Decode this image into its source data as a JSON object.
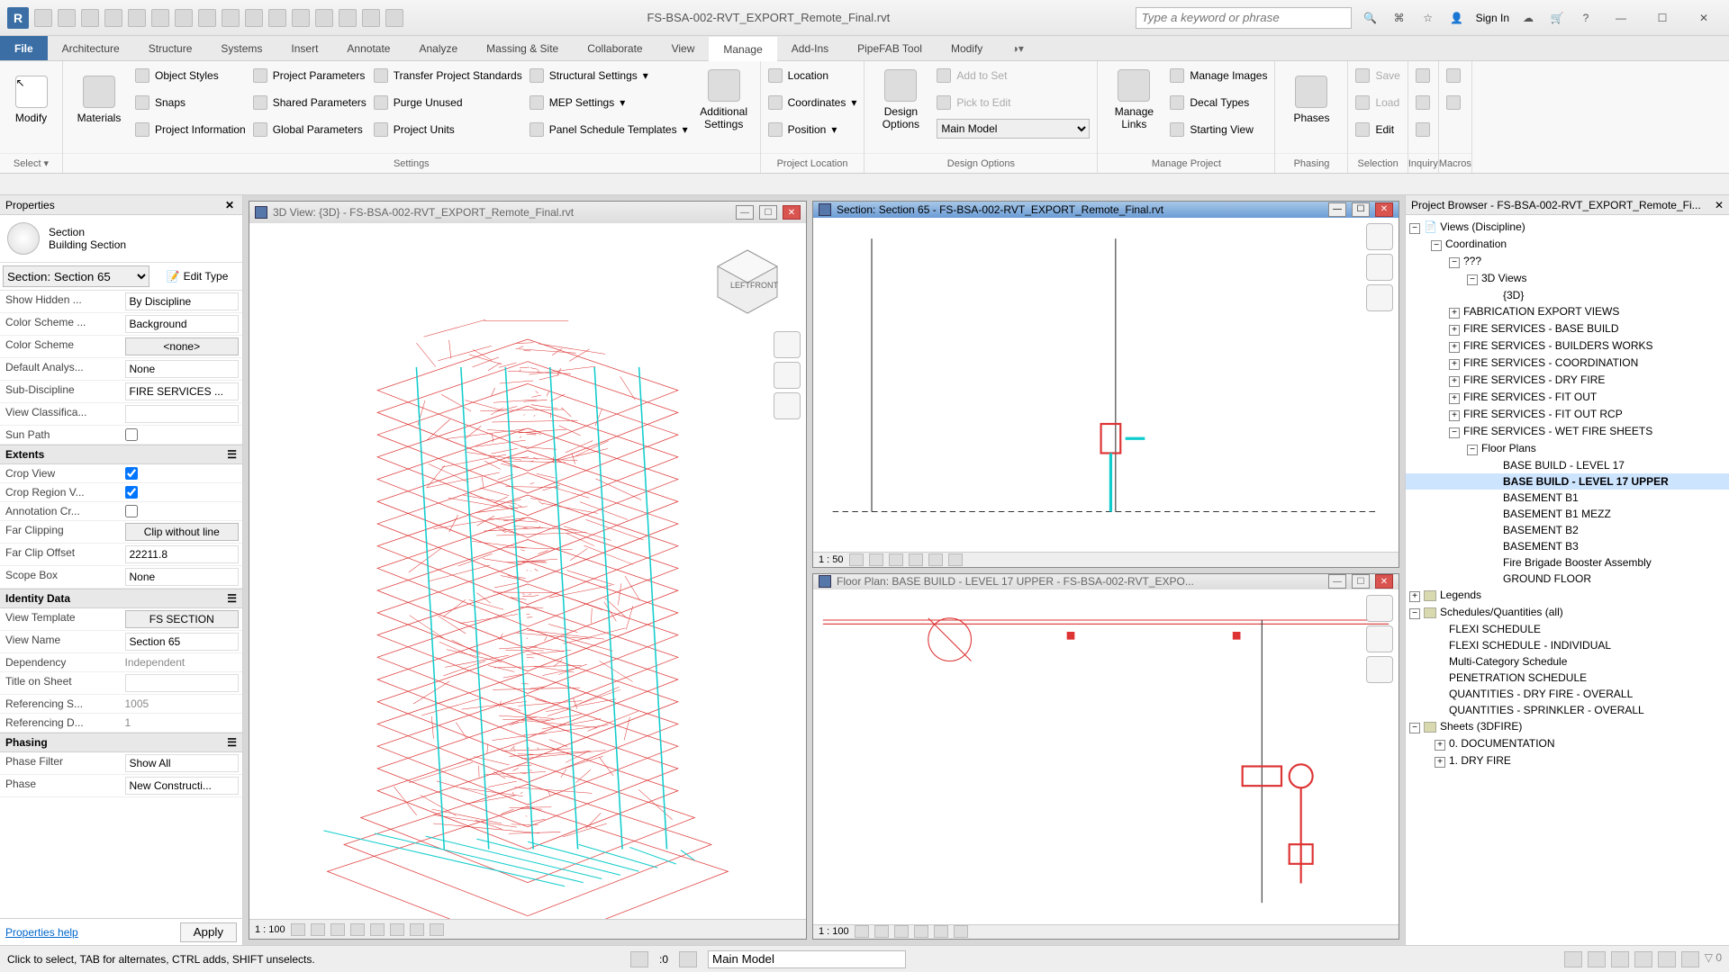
{
  "title": "FS-BSA-002-RVT_EXPORT_Remote_Final.rvt",
  "search_placeholder": "Type a keyword or phrase",
  "sign_in": "Sign In",
  "ribbon_tabs": [
    "File",
    "Architecture",
    "Structure",
    "Systems",
    "Insert",
    "Annotate",
    "Analyze",
    "Massing & Site",
    "Collaborate",
    "View",
    "Manage",
    "Add-Ins",
    "PipeFAB Tool",
    "Modify"
  ],
  "active_tab": "Manage",
  "options": {
    "select_label": "Select"
  },
  "ribbon": {
    "modify": "Modify",
    "materials": "Materials",
    "styles": {
      "object_styles": "Object  Styles",
      "snaps": "Snaps",
      "project_info": "Project  Information"
    },
    "params": {
      "project": "Project  Parameters",
      "shared": "Shared  Parameters",
      "global": "Global  Parameters"
    },
    "transfer": {
      "transfer": "Transfer  Project Standards",
      "purge": "Purge  Unused",
      "units": "Project  Units"
    },
    "settings_footer": "Settings",
    "mep": {
      "structural": "Structural  Settings",
      "mep": "MEP  Settings",
      "panel": "Panel Schedule  Templates"
    },
    "additional": "Additional\nSettings",
    "loc": {
      "location": "Location",
      "coordinates": "Coordinates",
      "position": "Position"
    },
    "project_location_footer": "Project Location",
    "design_options": "Design\nOptions",
    "do": {
      "add": "Add to Set",
      "pick": "Pick to Edit",
      "main_model": "Main Model"
    },
    "design_options_footer": "Design Options",
    "manage_links": "Manage\nLinks",
    "mp": {
      "images": "Manage  Images",
      "decal": "Decal  Types",
      "starting": "Starting  View"
    },
    "manage_project_footer": "Manage Project",
    "phases": "Phases",
    "phasing_footer": "Phasing",
    "sel": {
      "save": "Save",
      "load": "Load",
      "edit": "Edit"
    },
    "selection_footer": "Selection",
    "inquiry_footer": "Inquiry",
    "macros_footer": "Macros"
  },
  "properties": {
    "title": "Properties",
    "type_name": "Section",
    "type_family": "Building Section",
    "instance": "Section: Section 65",
    "edit_type": "Edit Type",
    "groups": [
      {
        "name": "",
        "rows": [
          {
            "k": "Show Hidden ...",
            "v": "By Discipline",
            "t": "text"
          },
          {
            "k": "Color Scheme ...",
            "v": "Background",
            "t": "text"
          },
          {
            "k": "Color Scheme",
            "v": "<none>",
            "t": "btn"
          },
          {
            "k": "Default Analys...",
            "v": "None",
            "t": "text"
          },
          {
            "k": "Sub-Discipline",
            "v": "FIRE SERVICES ...",
            "t": "text"
          },
          {
            "k": "View Classifica...",
            "v": "",
            "t": "text"
          },
          {
            "k": "Sun Path",
            "v": "",
            "t": "check",
            "checked": false
          }
        ]
      },
      {
        "name": "Extents",
        "rows": [
          {
            "k": "Crop View",
            "v": "",
            "t": "check",
            "checked": true
          },
          {
            "k": "Crop Region V...",
            "v": "",
            "t": "check",
            "checked": true
          },
          {
            "k": "Annotation Cr...",
            "v": "",
            "t": "check",
            "checked": false
          },
          {
            "k": "Far Clipping",
            "v": "Clip without line",
            "t": "btn"
          },
          {
            "k": "Far Clip Offset",
            "v": "22211.8",
            "t": "text"
          },
          {
            "k": "Scope Box",
            "v": "None",
            "t": "text"
          }
        ]
      },
      {
        "name": "Identity Data",
        "rows": [
          {
            "k": "View Template",
            "v": "FS SECTION",
            "t": "btn"
          },
          {
            "k": "View Name",
            "v": "Section 65",
            "t": "text"
          },
          {
            "k": "Dependency",
            "v": "Independent",
            "t": "ro"
          },
          {
            "k": "Title on Sheet",
            "v": "",
            "t": "text"
          },
          {
            "k": "Referencing S...",
            "v": "1005",
            "t": "ro"
          },
          {
            "k": "Referencing D...",
            "v": "1",
            "t": "ro"
          }
        ]
      },
      {
        "name": "Phasing",
        "rows": [
          {
            "k": "Phase Filter",
            "v": "Show All",
            "t": "text"
          },
          {
            "k": "Phase",
            "v": "New Constructi...",
            "t": "text"
          }
        ]
      }
    ],
    "help": "Properties help",
    "apply": "Apply"
  },
  "viewports": {
    "section": {
      "title": "Section: Section 65 - FS-BSA-002-RVT_EXPORT_Remote_Final.rvt",
      "scale": "1 : 50"
    },
    "plan": {
      "title": "Floor Plan: BASE BUILD - LEVEL 17 UPPER - FS-BSA-002-RVT_EXPO...",
      "scale": "1 : 100"
    },
    "threed": {
      "title": "3D View: {3D} - FS-BSA-002-RVT_EXPORT_Remote_Final.rvt",
      "scale": "1 : 100"
    }
  },
  "browser": {
    "title": "Project Browser - FS-BSA-002-RVT_EXPORT_Remote_Fi...",
    "views_root": "Views (Discipline)",
    "coord": "Coordination",
    "qqq": "???",
    "threed_views": "3D Views",
    "threed_item": "{3D}",
    "cats": [
      "FABRICATION EXPORT VIEWS",
      "FIRE SERVICES - BASE BUILD",
      "FIRE SERVICES - BUILDERS WORKS",
      "FIRE SERVICES - COORDINATION",
      "FIRE SERVICES - DRY FIRE",
      "FIRE SERVICES - FIT OUT",
      "FIRE SERVICES - FIT OUT RCP"
    ],
    "wet": "FIRE SERVICES - WET FIRE SHEETS",
    "floor_plans": "Floor Plans",
    "fp_items": [
      "BASE BUILD - LEVEL 17",
      "BASE BUILD - LEVEL 17 UPPER",
      "BASEMENT B1",
      "BASEMENT B1 MEZZ",
      "BASEMENT B2",
      "BASEMENT B3",
      "Fire Brigade Booster Assembly",
      "GROUND FLOOR"
    ],
    "fp_selected": 1,
    "legends": "Legends",
    "schedules": "Schedules/Quantities (all)",
    "sched_items": [
      "FLEXI SCHEDULE",
      "FLEXI SCHEDULE - INDIVIDUAL",
      "Multi-Category Schedule",
      "PENETRATION SCHEDULE",
      "QUANTITIES - DRY FIRE - OVERALL",
      "QUANTITIES - SPRINKLER - OVERALL"
    ],
    "sheets": "Sheets (3DFIRE)",
    "sheet_items": [
      "0. DOCUMENTATION",
      "1. DRY FIRE"
    ]
  },
  "status": {
    "msg": "Click to select, TAB for alternates, CTRL adds, SHIFT unselects.",
    "zero": ":0",
    "main_model": "Main Model"
  }
}
